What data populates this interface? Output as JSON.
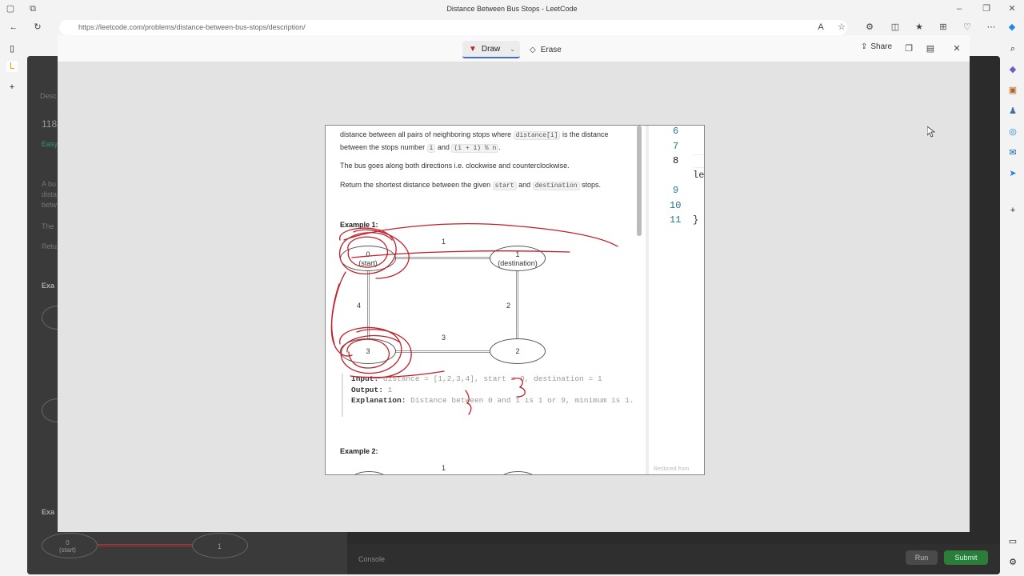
{
  "browser": {
    "title": "Distance Between Bus Stops - LeetCode",
    "url": "https://leetcode.com/problems/distance-between-bus-stops/description/"
  },
  "underlying": {
    "tab_partial": "Desc",
    "problem_partial": "118",
    "difficulty_partial": "Easy",
    "text_partial_1": "A bu",
    "text_partial_2": "dista",
    "text_partial_3": "betw",
    "text_partial_4": "The",
    "text_partial_5": "Retu",
    "example_partial": "Exa",
    "node0": "0\n(start)",
    "node1": "1",
    "console_label": "Console",
    "run_label": "Run",
    "submit_label": "Submit"
  },
  "overlay": {
    "draw_label": "Draw",
    "erase_label": "Erase",
    "share_label": "Share"
  },
  "snapshot": {
    "p1_a": "distance between all pairs of neighboring stops where",
    "p1_code1": "distance[i]",
    "p1_b": "is the distance",
    "p1_c": "between the stops number",
    "p1_code2": "i",
    "p1_d": "and",
    "p1_code3": "(i + 1) % n",
    "p1_e": ".",
    "p2": "The bus goes along both directions i.e. clockwise and counterclockwise.",
    "p3_a": "Return the shortest distance between the given",
    "p3_code1": "start",
    "p3_b": "and",
    "p3_code2": "destination",
    "p3_c": "stops.",
    "example1_title": "Example 1:",
    "example2_title": "Example 2:",
    "graph": {
      "node0_num": "0",
      "node0_tag": "(start)",
      "node1_num": "1",
      "node1_tag": "(destination)",
      "node2": "2",
      "node3": "3",
      "edge_top": "1",
      "edge_right": "2",
      "edge_bottom": "3",
      "edge_left": "4",
      "edge_top_ex2": "1"
    },
    "input_label": "Input:",
    "input_value": "distance = [1,2,3,4], start = 0, destination = 1",
    "output_label": "Output:",
    "output_value": "1",
    "explanation_label": "Explanation:",
    "explanation_value": "Distance between 0 and 1 is 1 or 9, minimum is 1.",
    "line_numbers": [
      "6",
      "7",
      "8",
      "9",
      "10",
      "11"
    ],
    "code_le": "le",
    "code_brace": "}",
    "restored": "Restored from"
  },
  "colors": {
    "ink": "#c0202a",
    "accent": "#3b6fd6",
    "submit": "#2d7d3a"
  }
}
